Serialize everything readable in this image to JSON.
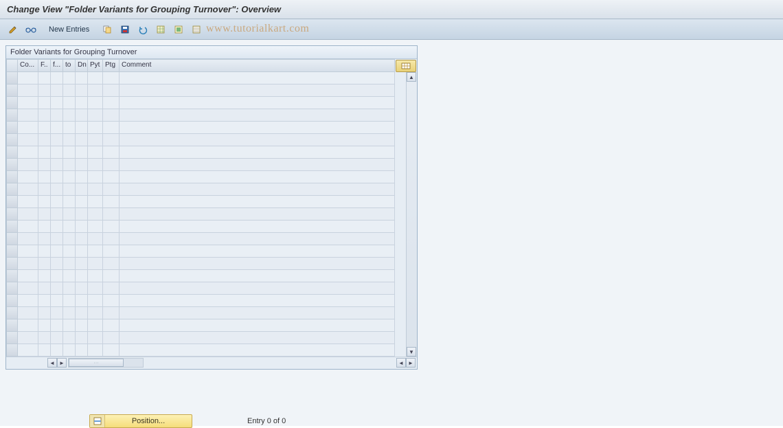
{
  "title": "Change View \"Folder Variants for Grouping Turnover\": Overview",
  "toolbar": {
    "icons": {
      "edit": "edit-icon",
      "glasses": "glasses-icon",
      "copy": "copy-icon",
      "save_down": "save-down-icon",
      "undo": "undo-icon",
      "select_all": "select-all-icon",
      "select_block": "select-block-icon",
      "deselect": "deselect-icon"
    },
    "new_entries_label": "New Entries"
  },
  "panel": {
    "title": "Folder Variants for Grouping Turnover",
    "columns": {
      "co": "Co...",
      "f1": "F..",
      "f2": "f...",
      "to": "to",
      "dn": "Dn",
      "pyt": "Pyt",
      "ptg": "Ptg",
      "comment": "Comment"
    },
    "row_count": 23,
    "rows": []
  },
  "footer": {
    "position_label": "Position...",
    "entry_text": "Entry 0 of 0"
  },
  "watermark": "www.tutorialkart.com",
  "colors": {
    "header_bg": "#d9e1ea",
    "panel_border": "#9db4c9",
    "button_yellow": "#f5dd7a"
  }
}
